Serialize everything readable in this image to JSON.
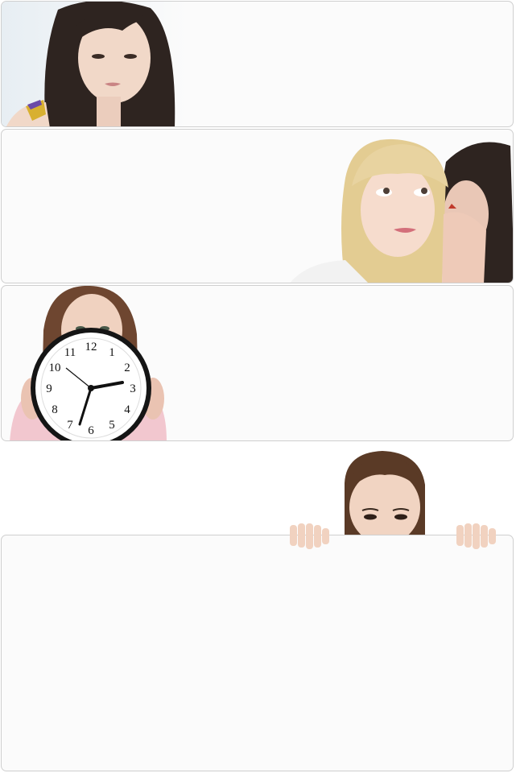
{
  "panels": [
    {
      "id": "panel-1",
      "photo": "woman-portrait-photo"
    },
    {
      "id": "panel-2",
      "photo": "two-women-whispering-photo"
    },
    {
      "id": "panel-3",
      "photo": "woman-holding-clock-photo"
    },
    {
      "id": "panel-4",
      "photo": "woman-peeking-over-board-photo"
    },
    {
      "id": "panel-5",
      "photo": "blank-board"
    }
  ],
  "clock": {
    "numerals": [
      "12",
      "1",
      "2",
      "3",
      "4",
      "5",
      "6",
      "7",
      "8",
      "9",
      "10",
      "11"
    ]
  },
  "colors": {
    "panel_background": "#fbfbfb",
    "panel_border": "#cfcfcf",
    "hair_dark": "#2e2420",
    "hair_blonde": "#e3cc92",
    "skin": "#f1d8c8"
  }
}
